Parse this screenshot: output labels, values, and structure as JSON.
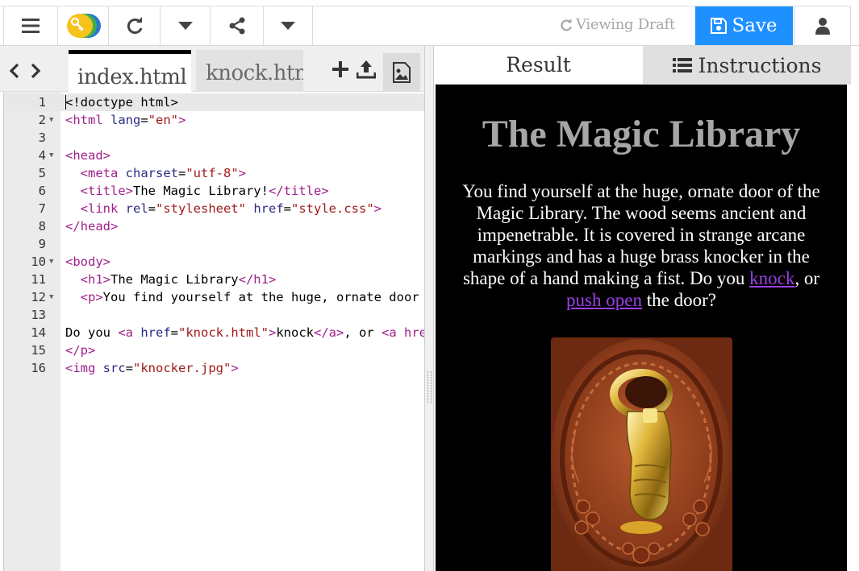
{
  "toolbar": {
    "status_label": "Viewing Draft",
    "save_label": "Save"
  },
  "editor": {
    "tabs": [
      {
        "label": "index.html"
      },
      {
        "label": "knock.html"
      }
    ],
    "lines": [
      {
        "num": "1",
        "fold": ""
      },
      {
        "num": "2",
        "fold": "▼"
      },
      {
        "num": "3",
        "fold": ""
      },
      {
        "num": "4",
        "fold": "▼"
      },
      {
        "num": "5",
        "fold": ""
      },
      {
        "num": "6",
        "fold": ""
      },
      {
        "num": "7",
        "fold": ""
      },
      {
        "num": "8",
        "fold": ""
      },
      {
        "num": "9",
        "fold": ""
      },
      {
        "num": "10",
        "fold": "▼"
      },
      {
        "num": "11",
        "fold": ""
      },
      {
        "num": "12",
        "fold": "▼"
      },
      {
        "num": "13",
        "fold": ""
      },
      {
        "num": "14",
        "fold": ""
      },
      {
        "num": "15",
        "fold": ""
      },
      {
        "num": "16",
        "fold": ""
      }
    ],
    "code": [
      [
        [
          "p",
          "<!doctype html>"
        ]
      ],
      [
        [
          "t",
          "<html "
        ],
        [
          "a",
          "lang"
        ],
        [
          "p",
          "="
        ],
        [
          "s",
          "\"en\""
        ],
        [
          "t",
          ">"
        ]
      ],
      [],
      [
        [
          "t",
          "<head>"
        ]
      ],
      [
        [
          "p",
          "  "
        ],
        [
          "t",
          "<meta "
        ],
        [
          "a",
          "charset"
        ],
        [
          "p",
          "="
        ],
        [
          "s",
          "\"utf-8\""
        ],
        [
          "t",
          ">"
        ]
      ],
      [
        [
          "p",
          "  "
        ],
        [
          "t",
          "<title>"
        ],
        [
          "p",
          "The Magic Library!"
        ],
        [
          "t",
          "</title>"
        ]
      ],
      [
        [
          "p",
          "  "
        ],
        [
          "t",
          "<link "
        ],
        [
          "a",
          "rel"
        ],
        [
          "p",
          "="
        ],
        [
          "s",
          "\"stylesheet\""
        ],
        [
          "p",
          " "
        ],
        [
          "a",
          "href"
        ],
        [
          "p",
          "="
        ],
        [
          "s",
          "\"style.css\""
        ],
        [
          "t",
          ">"
        ]
      ],
      [
        [
          "t",
          "</head>"
        ]
      ],
      [],
      [
        [
          "t",
          "<body>"
        ]
      ],
      [
        [
          "p",
          "  "
        ],
        [
          "t",
          "<h1>"
        ],
        [
          "p",
          "The Magic Library"
        ],
        [
          "t",
          "</h1>"
        ]
      ],
      [
        [
          "p",
          "  "
        ],
        [
          "t",
          "<p>"
        ],
        [
          "p",
          "You find yourself at the huge, ornate door of the Magic Library."
        ]
      ],
      [],
      [
        [
          "p",
          "Do you "
        ],
        [
          "t",
          "<a "
        ],
        [
          "a",
          "href"
        ],
        [
          "p",
          "="
        ],
        [
          "s",
          "\"knock.html\""
        ],
        [
          "t",
          ">"
        ],
        [
          "p",
          "knock"
        ],
        [
          "t",
          "</a>"
        ],
        [
          "p",
          ", or "
        ],
        [
          "t",
          "<a href=\"push.html\">push open</a> the door?"
        ]
      ],
      [
        [
          "t",
          "</p>"
        ]
      ],
      [
        [
          "t",
          "<img "
        ],
        [
          "a",
          "src"
        ],
        [
          "p",
          "="
        ],
        [
          "s",
          "\"knocker.jpg\""
        ],
        [
          "t",
          ">"
        ]
      ]
    ]
  },
  "result": {
    "tab_result": "Result",
    "tab_instructions": "Instructions",
    "heading": "The Magic Library",
    "paragraph_text": "You find yourself at the huge, ornate door of the Magic Library. The wood seems ancient and impenetrable. It is covered in strange arcane markings and has a huge brass knocker in the shape of a hand making a fist. Do you ",
    "link_knock": "knock",
    "between": ", or ",
    "link_push": "push open",
    "ending": " the door?"
  },
  "colors": {
    "save_bg": "#1e90ff",
    "link": "#9c3fe6",
    "heading": "#a6a6a6",
    "tag": "#a0208b",
    "attr": "#2a2a86",
    "string": "#a11a1a"
  },
  "icons": [
    "menu-icon",
    "logo-icon",
    "refresh-icon",
    "caret-down-icon",
    "share-icon",
    "save-disk-icon",
    "user-icon",
    "code-arrows-icon",
    "plus-icon",
    "upload-icon",
    "image-icon",
    "list-icon"
  ]
}
